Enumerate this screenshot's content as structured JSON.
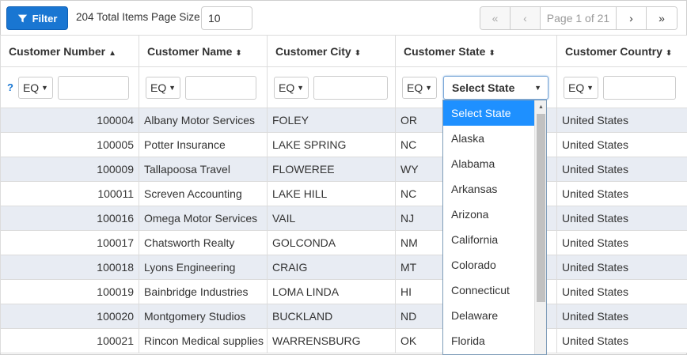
{
  "toolbar": {
    "filter_label": "Filter",
    "total_text": "204 Total Items Page Size",
    "page_size_value": "10"
  },
  "pager": {
    "first": "«",
    "prev": "‹",
    "label": "Page 1 of 21",
    "next": "›",
    "last": "»"
  },
  "columns": [
    {
      "label": "Customer Number",
      "sort": "▲"
    },
    {
      "label": "Customer Name",
      "sort": "⬍"
    },
    {
      "label": "Customer City",
      "sort": "⬍"
    },
    {
      "label": "Customer State",
      "sort": "⬍"
    },
    {
      "label": "Customer Country",
      "sort": "⬍"
    }
  ],
  "filters": {
    "help": "?",
    "operator": "EQ",
    "state_placeholder": "Select State"
  },
  "rows": [
    {
      "number": "100004",
      "name": "Albany Motor Services",
      "city": "FOLEY",
      "state": "OR",
      "country": "United States"
    },
    {
      "number": "100005",
      "name": "Potter Insurance",
      "city": "LAKE SPRING",
      "state": "NC",
      "country": "United States"
    },
    {
      "number": "100009",
      "name": "Tallapoosa Travel",
      "city": "FLOWEREE",
      "state": "WY",
      "country": "United States"
    },
    {
      "number": "100011",
      "name": "Screven Accounting",
      "city": "LAKE HILL",
      "state": "NC",
      "country": "United States"
    },
    {
      "number": "100016",
      "name": "Omega Motor Services",
      "city": "VAIL",
      "state": "NJ",
      "country": "United States"
    },
    {
      "number": "100017",
      "name": "Chatsworth Realty",
      "city": "GOLCONDA",
      "state": "NM",
      "country": "United States"
    },
    {
      "number": "100018",
      "name": "Lyons Engineering",
      "city": "CRAIG",
      "state": "MT",
      "country": "United States"
    },
    {
      "number": "100019",
      "name": "Bainbridge Industries",
      "city": "LOMA LINDA",
      "state": "HI",
      "country": "United States"
    },
    {
      "number": "100020",
      "name": "Montgomery Studios",
      "city": "BUCKLAND",
      "state": "ND",
      "country": "United States"
    },
    {
      "number": "100021",
      "name": "Rincon Medical supplies",
      "city": "WARRENSBURG",
      "state": "OK",
      "country": "United States"
    }
  ],
  "state_options": [
    "Select State",
    "Alaska",
    "Alabama",
    "Arkansas",
    "Arizona",
    "California",
    "Colorado",
    "Connecticut",
    "Delaware",
    "Florida"
  ],
  "colors": {
    "accent": "#1976d2",
    "row_alt": "#e8ecf3",
    "option_selected": "#1e90ff"
  }
}
